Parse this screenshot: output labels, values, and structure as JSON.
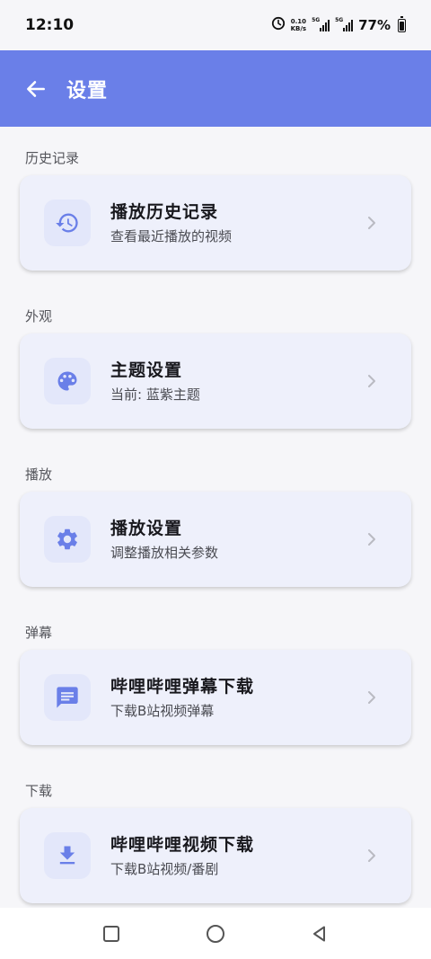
{
  "status_bar": {
    "time": "12:10",
    "net_speed_value": "0.10",
    "net_speed_unit": "KB/s",
    "signal_1_label": "5G",
    "signal_2_label": "5G",
    "battery_percent": "77%",
    "battery_level": 0.77
  },
  "app_bar": {
    "title": "设置"
  },
  "sections": [
    {
      "label": "历史记录",
      "card": {
        "title": "播放历史记录",
        "subtitle": "查看最近播放的视频",
        "icon": "history-icon"
      }
    },
    {
      "label": "外观",
      "card": {
        "title": "主题设置",
        "subtitle": "当前: 蓝紫主题",
        "icon": "palette-icon"
      }
    },
    {
      "label": "播放",
      "card": {
        "title": "播放设置",
        "subtitle": "调整播放相关参数",
        "icon": "gear-icon"
      }
    },
    {
      "label": "弹幕",
      "card": {
        "title": "哔哩哔哩弹幕下载",
        "subtitle": "下载B站视频弹幕",
        "icon": "message-icon"
      }
    },
    {
      "label": "下载",
      "card": {
        "title": "哔哩哔哩视频下载",
        "subtitle": "下载B站视频/番剧",
        "icon": "download-icon"
      }
    }
  ],
  "colors": {
    "accent": "#6a7fe8",
    "card_background": "#eef0fb",
    "icon_color": "#6a7fe8"
  },
  "nav_bar": {
    "recent_icon": "square-icon",
    "home_icon": "circle-icon",
    "back_icon": "triangle-back-icon"
  }
}
